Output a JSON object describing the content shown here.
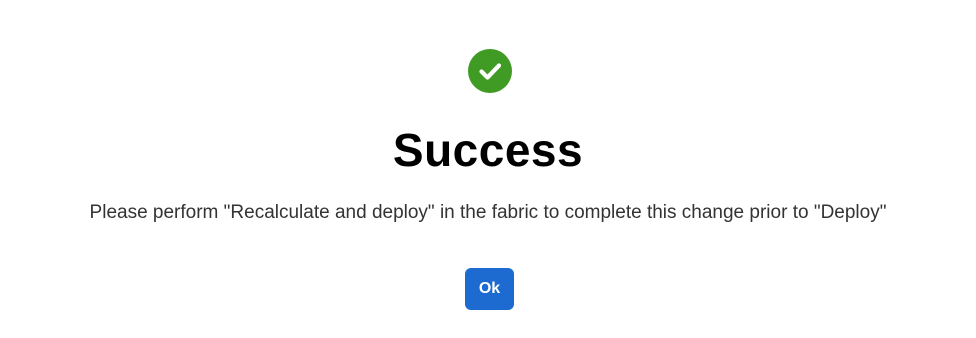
{
  "dialog": {
    "icon": "check-circle-icon",
    "status_color": "#3f9b24",
    "title": "Success",
    "message": "Please perform \"Recalculate and deploy\" in the fabric to complete this change prior to \"Deploy\"",
    "ok_label": "Ok",
    "accent": "#1d6bd0"
  }
}
